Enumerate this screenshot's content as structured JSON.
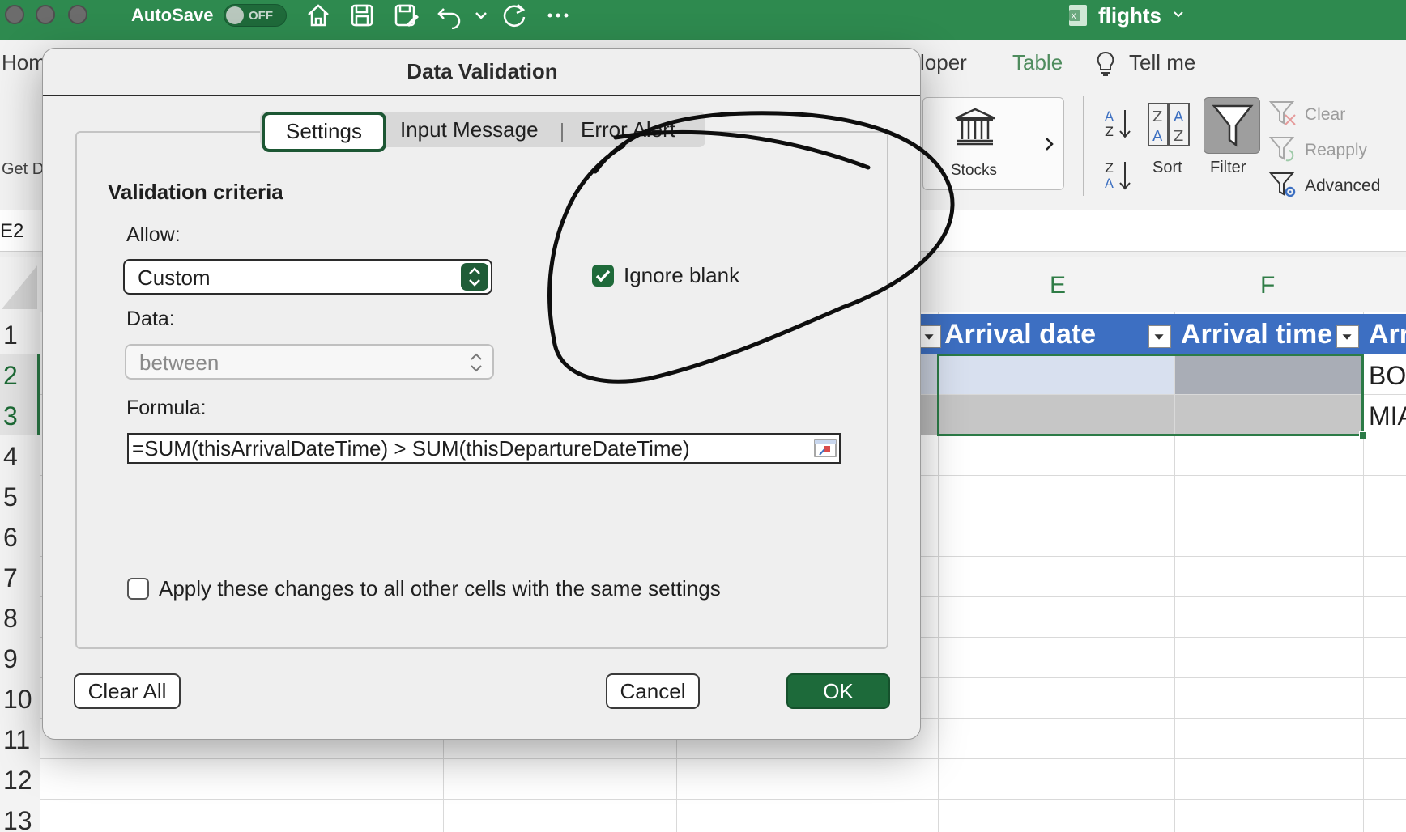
{
  "titlebar": {
    "autosave_label": "AutoSave",
    "autosave_state": "OFF",
    "document_title": "flights"
  },
  "ribbon": {
    "tabs": {
      "home_partial": "Hom",
      "developer_partial": "loper",
      "table": "Table",
      "tell_me": "Tell me"
    },
    "get_data_partial": "Get D",
    "stocks_label": "Stocks",
    "sort_label": "Sort",
    "filter_label": "Filter",
    "clear_label": "Clear",
    "reapply_label": "Reapply",
    "advanced_label": "Advanced"
  },
  "name_box": {
    "value": "E2"
  },
  "grid": {
    "columns": [
      "E",
      "F"
    ],
    "rows": [
      "1",
      "2",
      "3",
      "4",
      "5",
      "6",
      "7",
      "8",
      "9",
      "10",
      "11",
      "12",
      "13"
    ],
    "table_headers": [
      "Arrival date",
      "Arrival time",
      "Arr"
    ],
    "row2_partial": "BO",
    "row3_partial": "MIA"
  },
  "dialog": {
    "title": "Data Validation",
    "tabs": {
      "settings": "Settings",
      "input_message": "Input Message",
      "error_alert": "Error Alert"
    },
    "section_title": "Validation criteria",
    "allow_label": "Allow:",
    "allow_value": "Custom",
    "data_label": "Data:",
    "data_value": "between",
    "formula_label": "Formula:",
    "formula_value": "=SUM(thisArrivalDateTime) > SUM(thisDepartureDateTime)",
    "ignore_blank_label": "Ignore blank",
    "apply_all_label": "Apply these changes to all other cells with the same settings",
    "buttons": {
      "clear_all": "Clear All",
      "cancel": "Cancel",
      "ok": "OK"
    }
  },
  "colors": {
    "excel_green": "#2e8a4f",
    "table_header_blue": "#3d6fc2",
    "ok_button": "#1d6a3a"
  }
}
